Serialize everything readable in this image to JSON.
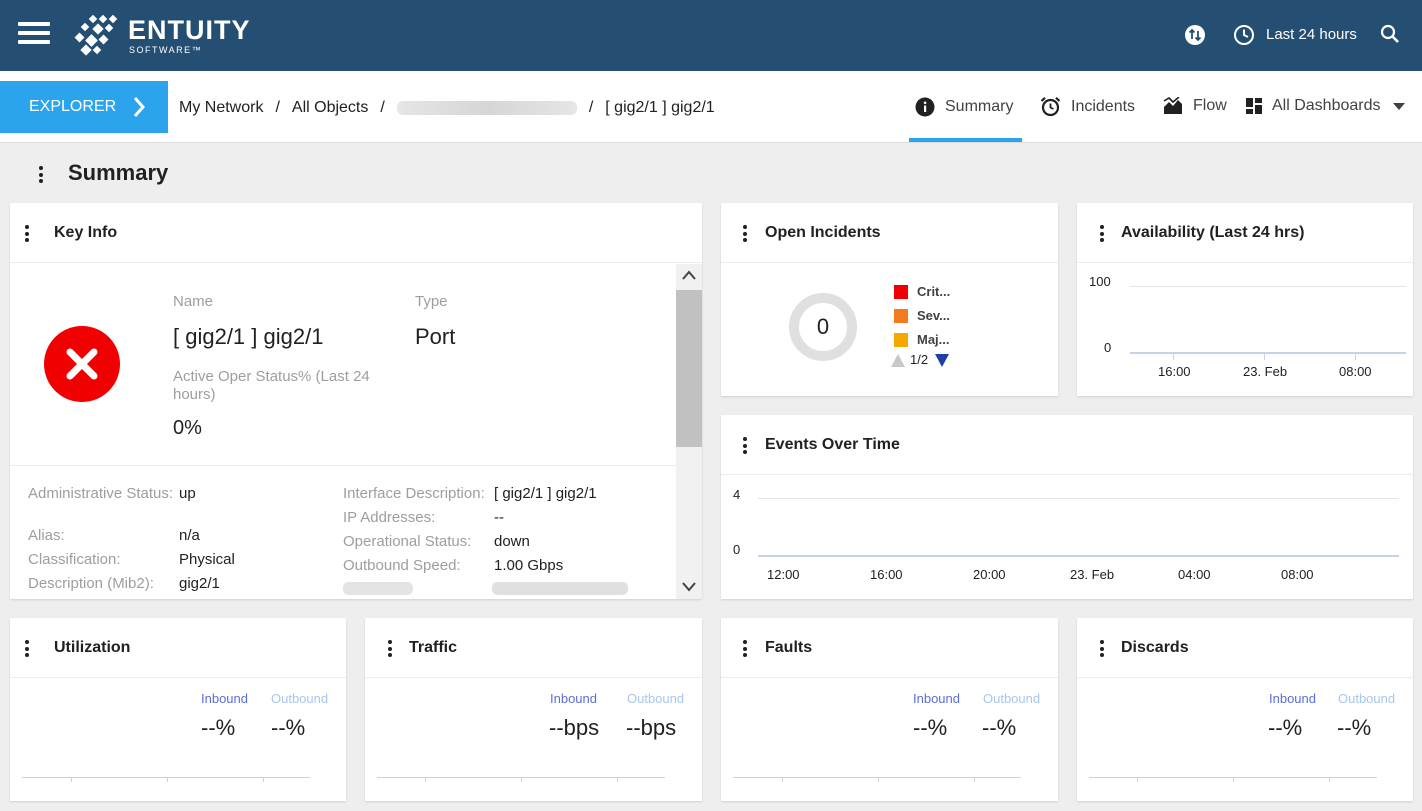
{
  "header": {
    "brand": "ENTUITY",
    "brand_sub": "SOFTWARE™",
    "time_range": "Last 24 hours",
    "icons": [
      "menu-icon",
      "sync-icon",
      "clock-icon",
      "search-icon"
    ]
  },
  "nav": {
    "explorer_label": "EXPLORER",
    "breadcrumb": [
      "My Network",
      "All Objects",
      "[ gig2/1 ] gig2/1"
    ],
    "tabs": [
      {
        "label": "Summary",
        "icon": "info-icon",
        "active": true
      },
      {
        "label": "Incidents",
        "icon": "alarm-icon",
        "active": false
      },
      {
        "label": "Flow",
        "icon": "area-chart-icon",
        "active": false
      },
      {
        "label": "All Dashboards",
        "icon": "dashboard-icon",
        "active": false
      }
    ]
  },
  "page": {
    "title": "Summary"
  },
  "key_info": {
    "title": "Key Info",
    "status_icon": "error-icon",
    "name_label": "Name",
    "name_value": "[ gig2/1 ] gig2/1",
    "type_label": "Type",
    "type_value": "Port",
    "active_label": "Active Oper Status% (Last 24 hours)",
    "active_value": "0%",
    "details_left": [
      {
        "label": "Administrative Status:",
        "value": "up"
      },
      {
        "label": "Alias:",
        "value": "n/a"
      },
      {
        "label": "Classification:",
        "value": "Physical"
      },
      {
        "label": "Description (Mib2):",
        "value": "gig2/1"
      }
    ],
    "details_right": [
      {
        "label": "Interface Description:",
        "value": "[ gig2/1 ] gig2/1"
      },
      {
        "label": "IP Addresses:",
        "value": "--"
      },
      {
        "label": "Operational Status:",
        "value": "down"
      },
      {
        "label": "Outbound Speed:",
        "value": "1.00 Gbps"
      }
    ]
  },
  "open_incidents": {
    "title": "Open Incidents",
    "count": "0",
    "legend": [
      {
        "label": "Crit...",
        "color": "#f00000"
      },
      {
        "label": "Sev...",
        "color": "#f47a21"
      },
      {
        "label": "Maj...",
        "color": "#f5a800"
      }
    ],
    "pager": "1/2"
  },
  "availability": {
    "title": "Availability (Last 24 hrs)",
    "y_ticks": [
      "100",
      "0"
    ],
    "x_ticks": [
      "16:00",
      "23. Feb",
      "08:00"
    ]
  },
  "events": {
    "title": "Events Over Time",
    "y_ticks": [
      "4",
      "0"
    ],
    "x_ticks": [
      "12:00",
      "16:00",
      "20:00",
      "23. Feb",
      "04:00",
      "08:00"
    ]
  },
  "io_labels": {
    "inbound": "Inbound",
    "outbound": "Outbound",
    "inbound_color": "#5b6fd6",
    "outbound_color": "#a8c6ec"
  },
  "utilization": {
    "title": "Utilization",
    "inbound": "--%",
    "outbound": "--%"
  },
  "traffic": {
    "title": "Traffic",
    "inbound": "--bps",
    "outbound": "--bps"
  },
  "faults": {
    "title": "Faults",
    "inbound": "--%",
    "outbound": "--%"
  },
  "discards": {
    "title": "Discards",
    "inbound": "--%",
    "outbound": "--%"
  }
}
